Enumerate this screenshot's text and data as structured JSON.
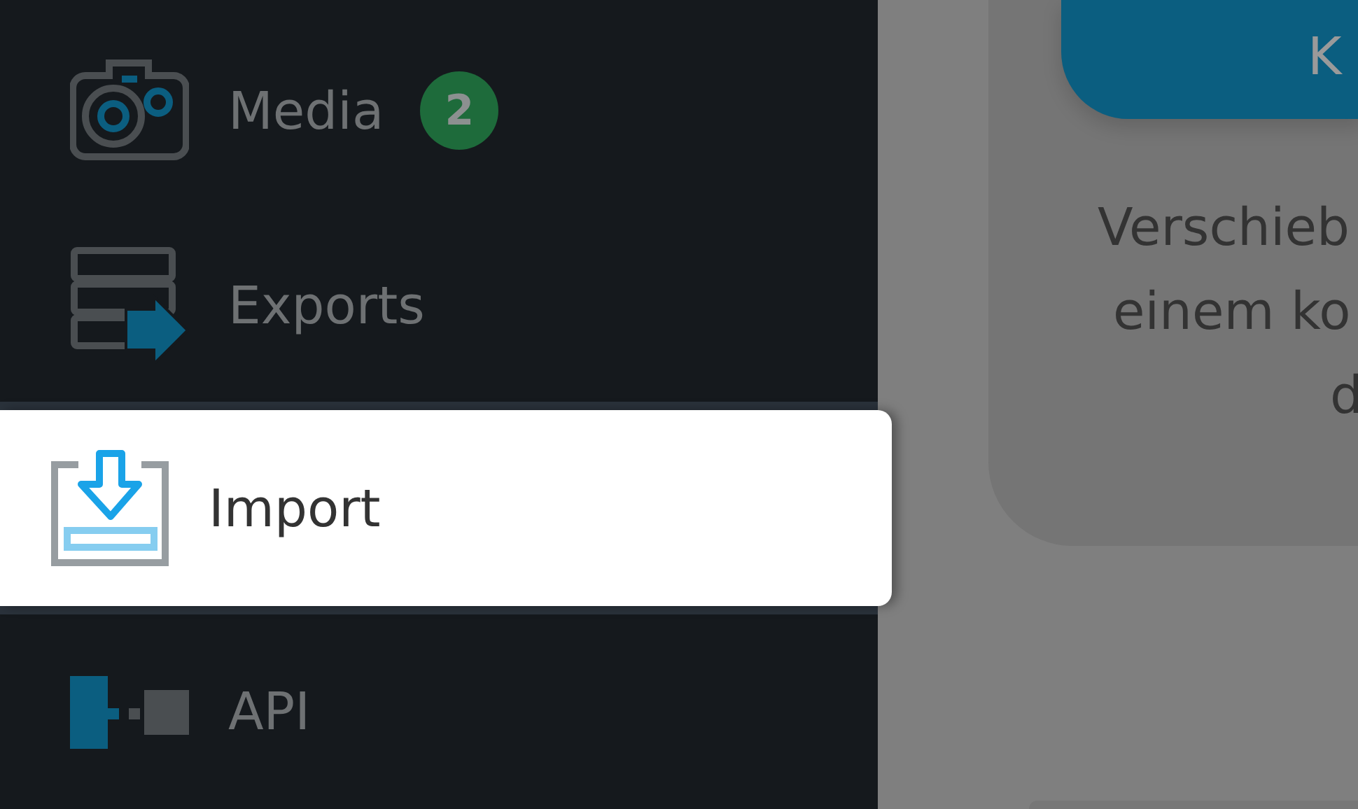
{
  "sidebar": {
    "items": [
      {
        "kind": "camera",
        "label": "Media",
        "badge": "2",
        "selected": false
      },
      {
        "kind": "export",
        "label": "Exports",
        "selected": false
      },
      {
        "kind": "import",
        "label": "Import",
        "selected": true
      },
      {
        "kind": "api",
        "label": "API",
        "selected": false
      }
    ]
  },
  "content": {
    "card": {
      "button_label": "K",
      "text_lines": [
        "Verschieb",
        "einem ko",
        "d"
      ]
    }
  }
}
